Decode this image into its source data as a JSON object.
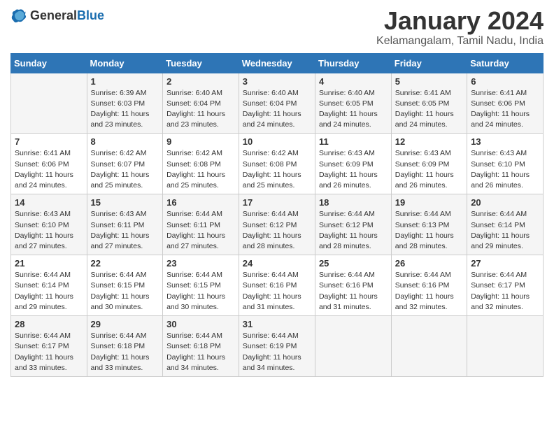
{
  "logo": {
    "general": "General",
    "blue": "Blue"
  },
  "header": {
    "title": "January 2024",
    "subtitle": "Kelamangalam, Tamil Nadu, India"
  },
  "days_of_week": [
    "Sunday",
    "Monday",
    "Tuesday",
    "Wednesday",
    "Thursday",
    "Friday",
    "Saturday"
  ],
  "weeks": [
    [
      null,
      {
        "day": "1",
        "sunrise": "Sunrise: 6:39 AM",
        "sunset": "Sunset: 6:03 PM",
        "daylight": "Daylight: 11 hours and 23 minutes."
      },
      {
        "day": "2",
        "sunrise": "Sunrise: 6:40 AM",
        "sunset": "Sunset: 6:04 PM",
        "daylight": "Daylight: 11 hours and 23 minutes."
      },
      {
        "day": "3",
        "sunrise": "Sunrise: 6:40 AM",
        "sunset": "Sunset: 6:04 PM",
        "daylight": "Daylight: 11 hours and 24 minutes."
      },
      {
        "day": "4",
        "sunrise": "Sunrise: 6:40 AM",
        "sunset": "Sunset: 6:05 PM",
        "daylight": "Daylight: 11 hours and 24 minutes."
      },
      {
        "day": "5",
        "sunrise": "Sunrise: 6:41 AM",
        "sunset": "Sunset: 6:05 PM",
        "daylight": "Daylight: 11 hours and 24 minutes."
      },
      {
        "day": "6",
        "sunrise": "Sunrise: 6:41 AM",
        "sunset": "Sunset: 6:06 PM",
        "daylight": "Daylight: 11 hours and 24 minutes."
      }
    ],
    [
      {
        "day": "7",
        "sunrise": "Sunrise: 6:41 AM",
        "sunset": "Sunset: 6:06 PM",
        "daylight": "Daylight: 11 hours and 24 minutes."
      },
      {
        "day": "8",
        "sunrise": "Sunrise: 6:42 AM",
        "sunset": "Sunset: 6:07 PM",
        "daylight": "Daylight: 11 hours and 25 minutes."
      },
      {
        "day": "9",
        "sunrise": "Sunrise: 6:42 AM",
        "sunset": "Sunset: 6:08 PM",
        "daylight": "Daylight: 11 hours and 25 minutes."
      },
      {
        "day": "10",
        "sunrise": "Sunrise: 6:42 AM",
        "sunset": "Sunset: 6:08 PM",
        "daylight": "Daylight: 11 hours and 25 minutes."
      },
      {
        "day": "11",
        "sunrise": "Sunrise: 6:43 AM",
        "sunset": "Sunset: 6:09 PM",
        "daylight": "Daylight: 11 hours and 26 minutes."
      },
      {
        "day": "12",
        "sunrise": "Sunrise: 6:43 AM",
        "sunset": "Sunset: 6:09 PM",
        "daylight": "Daylight: 11 hours and 26 minutes."
      },
      {
        "day": "13",
        "sunrise": "Sunrise: 6:43 AM",
        "sunset": "Sunset: 6:10 PM",
        "daylight": "Daylight: 11 hours and 26 minutes."
      }
    ],
    [
      {
        "day": "14",
        "sunrise": "Sunrise: 6:43 AM",
        "sunset": "Sunset: 6:10 PM",
        "daylight": "Daylight: 11 hours and 27 minutes."
      },
      {
        "day": "15",
        "sunrise": "Sunrise: 6:43 AM",
        "sunset": "Sunset: 6:11 PM",
        "daylight": "Daylight: 11 hours and 27 minutes."
      },
      {
        "day": "16",
        "sunrise": "Sunrise: 6:44 AM",
        "sunset": "Sunset: 6:11 PM",
        "daylight": "Daylight: 11 hours and 27 minutes."
      },
      {
        "day": "17",
        "sunrise": "Sunrise: 6:44 AM",
        "sunset": "Sunset: 6:12 PM",
        "daylight": "Daylight: 11 hours and 28 minutes."
      },
      {
        "day": "18",
        "sunrise": "Sunrise: 6:44 AM",
        "sunset": "Sunset: 6:12 PM",
        "daylight": "Daylight: 11 hours and 28 minutes."
      },
      {
        "day": "19",
        "sunrise": "Sunrise: 6:44 AM",
        "sunset": "Sunset: 6:13 PM",
        "daylight": "Daylight: 11 hours and 28 minutes."
      },
      {
        "day": "20",
        "sunrise": "Sunrise: 6:44 AM",
        "sunset": "Sunset: 6:14 PM",
        "daylight": "Daylight: 11 hours and 29 minutes."
      }
    ],
    [
      {
        "day": "21",
        "sunrise": "Sunrise: 6:44 AM",
        "sunset": "Sunset: 6:14 PM",
        "daylight": "Daylight: 11 hours and 29 minutes."
      },
      {
        "day": "22",
        "sunrise": "Sunrise: 6:44 AM",
        "sunset": "Sunset: 6:15 PM",
        "daylight": "Daylight: 11 hours and 30 minutes."
      },
      {
        "day": "23",
        "sunrise": "Sunrise: 6:44 AM",
        "sunset": "Sunset: 6:15 PM",
        "daylight": "Daylight: 11 hours and 30 minutes."
      },
      {
        "day": "24",
        "sunrise": "Sunrise: 6:44 AM",
        "sunset": "Sunset: 6:16 PM",
        "daylight": "Daylight: 11 hours and 31 minutes."
      },
      {
        "day": "25",
        "sunrise": "Sunrise: 6:44 AM",
        "sunset": "Sunset: 6:16 PM",
        "daylight": "Daylight: 11 hours and 31 minutes."
      },
      {
        "day": "26",
        "sunrise": "Sunrise: 6:44 AM",
        "sunset": "Sunset: 6:16 PM",
        "daylight": "Daylight: 11 hours and 32 minutes."
      },
      {
        "day": "27",
        "sunrise": "Sunrise: 6:44 AM",
        "sunset": "Sunset: 6:17 PM",
        "daylight": "Daylight: 11 hours and 32 minutes."
      }
    ],
    [
      {
        "day": "28",
        "sunrise": "Sunrise: 6:44 AM",
        "sunset": "Sunset: 6:17 PM",
        "daylight": "Daylight: 11 hours and 33 minutes."
      },
      {
        "day": "29",
        "sunrise": "Sunrise: 6:44 AM",
        "sunset": "Sunset: 6:18 PM",
        "daylight": "Daylight: 11 hours and 33 minutes."
      },
      {
        "day": "30",
        "sunrise": "Sunrise: 6:44 AM",
        "sunset": "Sunset: 6:18 PM",
        "daylight": "Daylight: 11 hours and 34 minutes."
      },
      {
        "day": "31",
        "sunrise": "Sunrise: 6:44 AM",
        "sunset": "Sunset: 6:19 PM",
        "daylight": "Daylight: 11 hours and 34 minutes."
      },
      null,
      null,
      null
    ]
  ]
}
